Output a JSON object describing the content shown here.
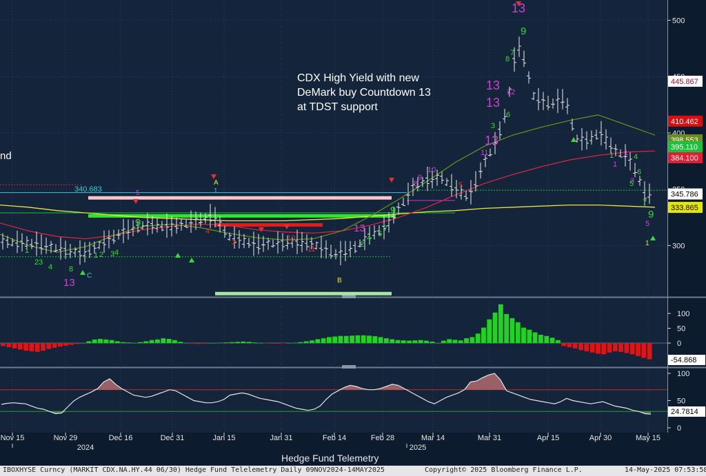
{
  "chart_data": [
    {
      "type": "candlestick",
      "title": "",
      "annotation": [
        "CDX High Yield with new",
        "DeMark buy Countdown 13",
        "at TDST support"
      ],
      "y_ticks": [
        300,
        350,
        400,
        450,
        500
      ],
      "ylim": [
        255,
        518
      ],
      "price_labels": [
        {
          "text": "445.867",
          "value": 445.867,
          "bg": "#ffffff",
          "fg": "#c0002a"
        },
        {
          "text": "410.462",
          "value": 410.462,
          "bg": "#d41010",
          "fg": "#ffffff"
        },
        {
          "text": "398.553",
          "value": 398.553,
          "bg": "#6a8e1e",
          "fg": "#ffffff"
        },
        {
          "text": "395.110",
          "value": 393.9,
          "bg": "#1fbf3a",
          "fg": "#ffffff"
        },
        {
          "text": "384.100",
          "value": 384.1,
          "bg": "#e01f34",
          "fg": "#ffffff"
        },
        {
          "text": "345.786",
          "value": 345.786,
          "bg": "#ffffff",
          "fg": "#000000"
        },
        {
          "text": "333.865",
          "value": 333.865,
          "bg": "#e6e600",
          "fg": "#000000"
        }
      ],
      "left_value_label": "340.683",
      "series": [
        {
          "name": "",
          "color": "#e6e63c",
          "values": [
            336,
            334,
            331,
            329,
            327,
            325,
            324,
            323,
            322,
            322,
            322,
            323,
            324,
            326,
            328,
            330,
            331,
            333,
            334,
            335,
            336,
            336,
            335,
            334
          ]
        },
        {
          "name": "",
          "color": "#d02840",
          "values": [
            320,
            313,
            308,
            306,
            309,
            314,
            317,
            319,
            318,
            314,
            312,
            311,
            313,
            318,
            325,
            334,
            345,
            355,
            363,
            370,
            376,
            380,
            383,
            384
          ]
        },
        {
          "name": "",
          "color": "#5f8f1f",
          "values": [
            310,
            300,
            294,
            299,
            309,
            317,
            319,
            316,
            311,
            307,
            305,
            306,
            313,
            326,
            341,
            357,
            374,
            388,
            398,
            405,
            411,
            416,
            407,
            398
          ]
        }
      ],
      "levels": [
        {
          "label": "TDST",
          "value": 342,
          "color": "#f5c6cb"
        },
        {
          "label": "",
          "value": 326,
          "color": "#2ee62e"
        },
        {
          "label": "",
          "value": 318,
          "color": "#e01c1c"
        },
        {
          "label": "",
          "value": 257,
          "color": "#a8e6a8"
        }
      ],
      "countdown_labels": [
        "13",
        "13",
        "13",
        "13",
        "13",
        "13"
      ]
    },
    {
      "type": "bar",
      "y_ticks": [
        100,
        50,
        0
      ],
      "last_value_label": "-54.868",
      "positive_color": "#1fd51f",
      "negative_color": "#e01414",
      "values": [
        -10,
        -14,
        -18,
        -22,
        -26,
        -28,
        -30,
        -26,
        -20,
        -16,
        -12,
        -9,
        -6,
        -3,
        0,
        6,
        12,
        14,
        12,
        10,
        6,
        3,
        2,
        0,
        3,
        6,
        10,
        12,
        16,
        14,
        10,
        4,
        0,
        -2,
        -3,
        -2,
        0,
        0,
        1,
        2,
        3,
        4,
        5,
        4,
        2,
        0,
        -1,
        -2,
        -2,
        -1,
        0,
        1,
        3,
        6,
        9,
        13,
        16,
        20,
        22,
        24,
        24,
        25,
        26,
        26,
        25,
        23,
        20,
        16,
        13,
        10,
        9,
        8,
        9,
        10,
        8,
        5,
        0,
        8,
        13,
        11,
        9,
        16,
        20,
        32,
        52,
        80,
        103,
        131,
        98,
        84,
        70,
        52,
        45,
        36,
        28,
        24,
        18,
        10,
        -10,
        -14,
        -18,
        -24,
        -28,
        -32,
        -36,
        -38,
        -32,
        -28,
        -30,
        -34,
        -38,
        -44,
        -50,
        -55
      ]
    },
    {
      "type": "line",
      "y_ticks": [
        100,
        50,
        0
      ],
      "last_value_label": "24.7814",
      "color": "#e6e6e6",
      "upper_line": 70,
      "lower_line": 30,
      "values": [
        43,
        45,
        46,
        45,
        44,
        40,
        36,
        34,
        30,
        26,
        27,
        38,
        49,
        56,
        61,
        66,
        72,
        84,
        90,
        80,
        72,
        66,
        60,
        58,
        56,
        58,
        62,
        66,
        70,
        68,
        62,
        56,
        50,
        48,
        46,
        46,
        48,
        52,
        60,
        62,
        64,
        62,
        58,
        54,
        52,
        50,
        48,
        44,
        40,
        36,
        34,
        32,
        34,
        40,
        52,
        62,
        68,
        74,
        78,
        76,
        72,
        70,
        70,
        72,
        76,
        80,
        78,
        72,
        66,
        60,
        54,
        48,
        44,
        50,
        56,
        60,
        64,
        70,
        84,
        86,
        92,
        97,
        100,
        88,
        68,
        64,
        60,
        56,
        52,
        50,
        48,
        46,
        44,
        48,
        54,
        50,
        48,
        46,
        44,
        46,
        48,
        44,
        40,
        38,
        36,
        32,
        30,
        26,
        25
      ]
    }
  ],
  "x_axis": {
    "ticks": [
      "Nov 15",
      "Nov 29",
      "Dec 16",
      "Dec 31",
      "Jan 15",
      "Jan 31",
      "Feb 14",
      "Feb 28",
      "Mar 14",
      "Mar 31",
      "Apr 15",
      "Apr 30",
      "May 15"
    ],
    "years": [
      "2024",
      "2025"
    ]
  },
  "cut_label": "nd",
  "panel_title": "Hedge Fund Telemetry",
  "footer": {
    "left": "IBOXHYSE Curncy (MARKIT CDX.NA.HY.44 06/30) Hedge Fund Telelemetry  Daily 09NOV2024-14MAY2025",
    "center": "Copyright© 2025 Bloomberg Finance L.P.",
    "right": "14-May-2025 07:53:58"
  }
}
